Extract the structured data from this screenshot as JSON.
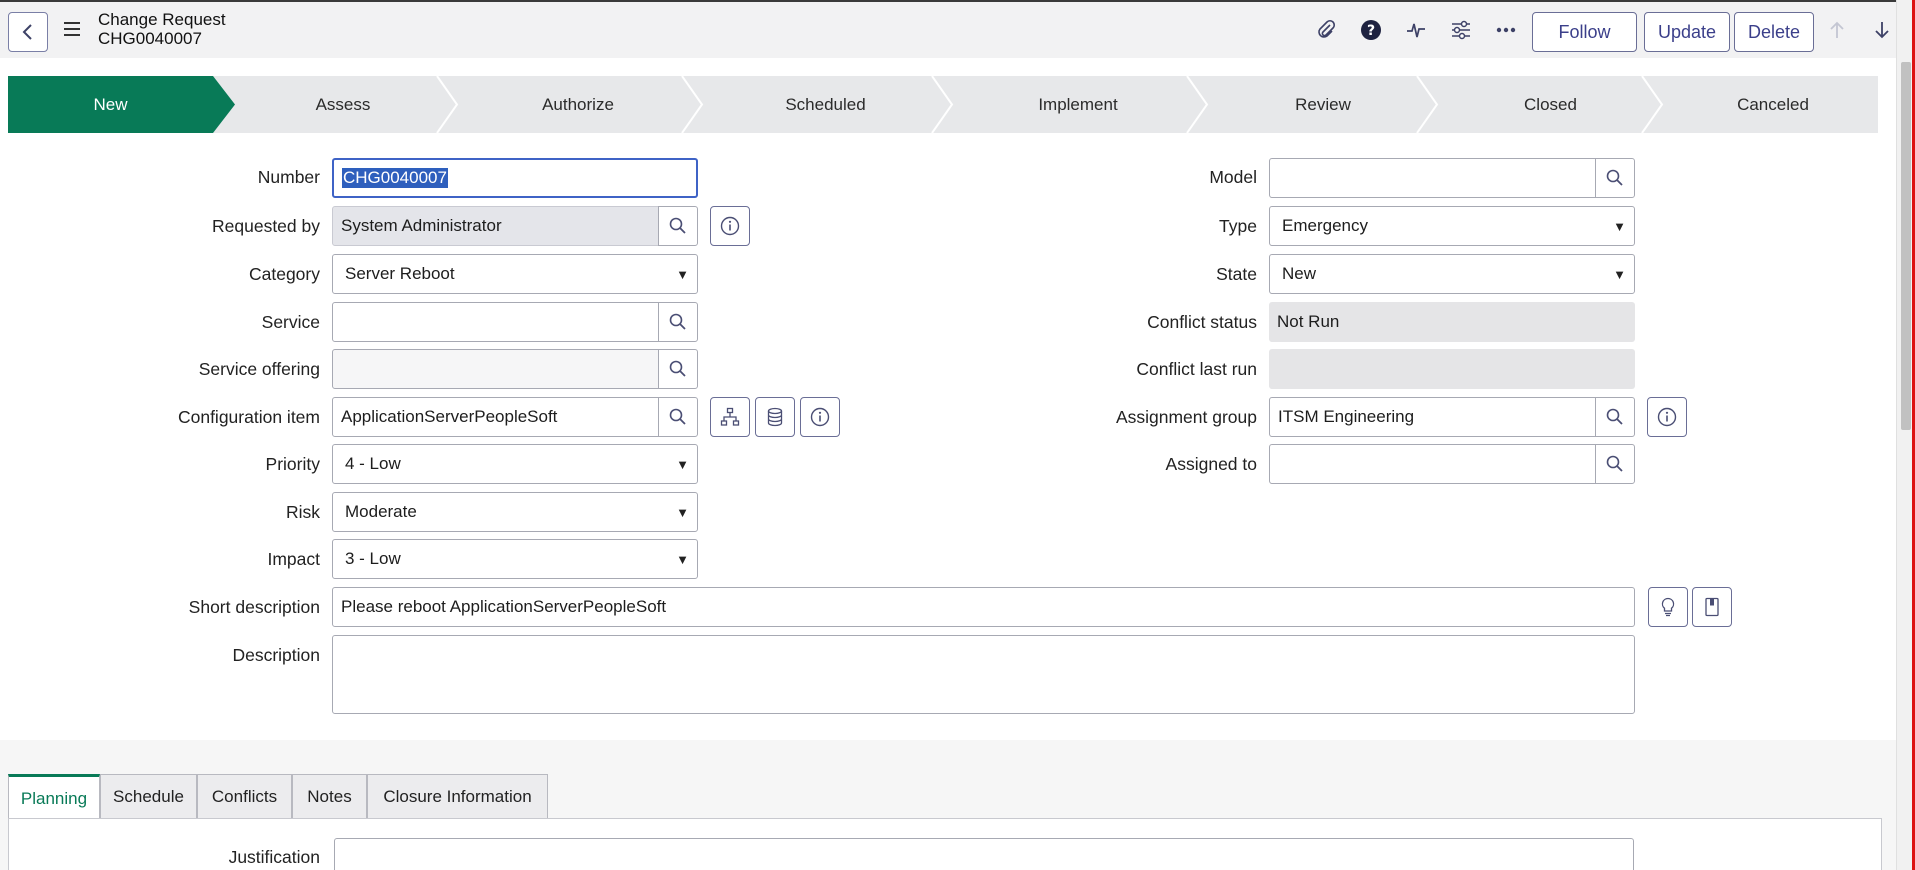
{
  "header": {
    "title": "Change Request",
    "number": "CHG0040007",
    "follow_label": "Follow",
    "update_label": "Update",
    "delete_label": "Delete"
  },
  "flow": {
    "steps": [
      "New",
      "Assess",
      "Authorize",
      "Scheduled",
      "Implement",
      "Review",
      "Closed",
      "Canceled"
    ],
    "active": "New"
  },
  "form": {
    "number": {
      "label": "Number",
      "value": "CHG0040007"
    },
    "requested_by": {
      "label": "Requested by",
      "value": "System Administrator"
    },
    "category": {
      "label": "Category",
      "value": "Server Reboot"
    },
    "service": {
      "label": "Service",
      "value": ""
    },
    "service_offering": {
      "label": "Service offering",
      "value": ""
    },
    "configuration_item": {
      "label": "Configuration item",
      "value": "ApplicationServerPeopleSoft"
    },
    "priority": {
      "label": "Priority",
      "value": "4 - Low"
    },
    "risk": {
      "label": "Risk",
      "value": "Moderate"
    },
    "impact": {
      "label": "Impact",
      "value": "3 - Low"
    },
    "short_description": {
      "label": "Short description",
      "value": "Please reboot ApplicationServerPeopleSoft"
    },
    "description": {
      "label": "Description",
      "value": ""
    },
    "model": {
      "label": "Model",
      "value": ""
    },
    "type": {
      "label": "Type",
      "value": "Emergency"
    },
    "state": {
      "label": "State",
      "value": "New"
    },
    "conflict_status": {
      "label": "Conflict status",
      "value": "Not Run"
    },
    "conflict_last_run": {
      "label": "Conflict last run",
      "value": ""
    },
    "assignment_group": {
      "label": "Assignment group",
      "value": "ITSM Engineering"
    },
    "assigned_to": {
      "label": "Assigned to",
      "value": ""
    }
  },
  "tabs": [
    "Planning",
    "Schedule",
    "Conflicts",
    "Notes",
    "Closure Information"
  ],
  "planning": {
    "justification_label": "Justification"
  },
  "colors": {
    "accent": "#087a57",
    "button_text": "#3b3f8a",
    "selection": "#2e5fbd"
  }
}
